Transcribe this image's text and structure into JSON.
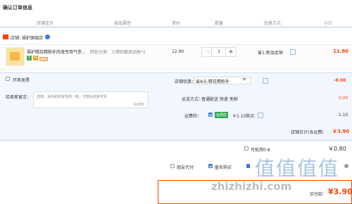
{
  "page_title": "确认订单信息",
  "columns": [
    "店铺宝贝",
    "商品属性",
    "单价",
    "数量",
    "优惠方式",
    "小计"
  ],
  "shop": {
    "label": "店铺：",
    "name": "福护旗舰店"
  },
  "item": {
    "title": "福护精花精粉补肉液专用气垫...",
    "props": "颜色分类：三佛奶酪商品粉*1",
    "price": "12.90",
    "qty": "1",
    "discount": "省1:新品促销",
    "subtotal": "11.90",
    "badges": [
      "7",
      "G"
    ]
  },
  "invoice": {
    "label": "开具发票"
  },
  "message": {
    "label": "给卖家留言：",
    "placeholder": "选填，请先和商家协商一致，付款后商家可见",
    "count": "0/200"
  },
  "shop_discount": {
    "label": "店铺优惠：",
    "value": "省8元:精花精粉补",
    "amount": "-8.00"
  },
  "shipping": {
    "label": "运送方式：",
    "value": "普通配送 快递 免邮",
    "amount": "0.00"
  },
  "insurance": {
    "label": "运费险：",
    "badge": "运费险",
    "value": "￥1.10购买",
    "amount": "1.10"
  },
  "shop_total": {
    "label": "店铺合计(含运费)",
    "amount": "￥3.90"
  },
  "coupon": {
    "label": "可抵用0.8",
    "amount": "￥0.80"
  },
  "options": {
    "friend_pay": "朋友代付",
    "anonymous": "匿名购买"
  },
  "final": {
    "label": "实付款：",
    "amount": "¥3.90"
  },
  "watermark": {
    "chars": "值值值值",
    "domain": "zhizhizhi.com"
  },
  "colors": {
    "accent": "#ff4400",
    "blue": "#3a7be0",
    "panel": "#f2f7ff",
    "border": "#b9d2ee"
  }
}
